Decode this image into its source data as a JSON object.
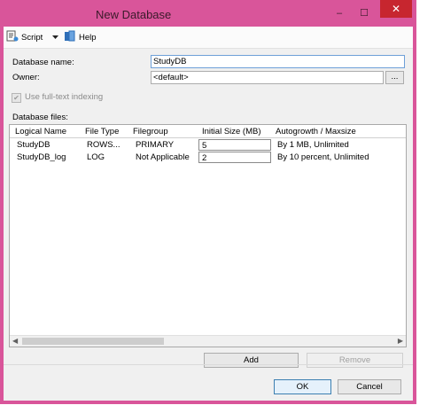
{
  "window": {
    "title": "New Database",
    "minimize": "–",
    "maximize": "☐",
    "close": "✕"
  },
  "toolbar": {
    "script_label": "Script",
    "help_label": "Help"
  },
  "form": {
    "database_name_label": "Database name:",
    "database_name_value": "StudyDB",
    "owner_label": "Owner:",
    "owner_value": "<default>",
    "owner_browse": "...",
    "fulltext_label": "Use full-text indexing",
    "fulltext_checked": true
  },
  "files": {
    "section_label": "Database files:",
    "columns": [
      "Logical Name",
      "File Type",
      "Filegroup",
      "Initial Size (MB)",
      "Autogrowth / Maxsize"
    ],
    "rows": [
      [
        "StudyDB",
        "ROWS...",
        "PRIMARY",
        "5",
        "By 1 MB, Unlimited"
      ],
      [
        "StudyDB_log",
        "LOG",
        "Not Applicable",
        "2",
        "By 10 percent, Unlimited"
      ]
    ]
  },
  "buttons": {
    "add": "Add",
    "remove": "Remove",
    "ok": "OK",
    "cancel": "Cancel"
  }
}
